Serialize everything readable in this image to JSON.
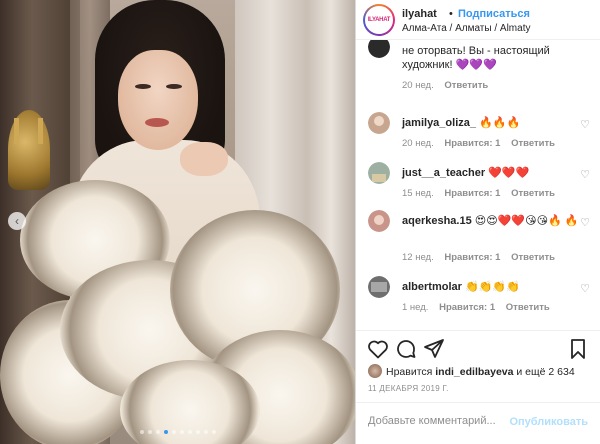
{
  "post": {
    "image_alt": "",
    "carousel": {
      "count": 10,
      "active_index": 3
    },
    "prev_icon": "chevron-left-icon"
  },
  "header": {
    "avatar_text": "ILYAHAT",
    "username": "ilyahat",
    "separator": "•",
    "follow_label": "Подписаться",
    "location": "Алма-Ата / Алматы / Almaty"
  },
  "comments": [
    {
      "username": "",
      "text": "не оторвать! Вы - настоящий художник! 💜💜💜",
      "time": "20 нед.",
      "likes": "",
      "reply": "Ответить",
      "avatar_color": "#2a2a2a",
      "has_heart": false
    },
    {
      "username": "jamilya_oliza_",
      "text": "🔥🔥🔥",
      "time": "20 нед.",
      "likes": "Нравится: 1",
      "reply": "Ответить",
      "avatar_color": "#c7a58f",
      "has_heart": true
    },
    {
      "username": "just__a_teacher",
      "text": "❤️❤️❤️",
      "time": "15 нед.",
      "likes": "Нравится: 1",
      "reply": "Ответить",
      "avatar_color": "#9db0a2",
      "has_heart": true
    },
    {
      "username": "aqerkesha.15",
      "text": "😍😍❤️❤️😘😘🔥 🔥",
      "time": "12 нед.",
      "likes": "Нравится: 1",
      "reply": "Ответить",
      "avatar_color": "#c9948a",
      "has_heart": true
    },
    {
      "username": "albertmolar",
      "text": "👏👏👏👏",
      "time": "1 нед.",
      "likes": "Нравится: 1",
      "reply": "Ответить",
      "avatar_color": "#6e6e6e",
      "has_heart": true
    }
  ],
  "actions": {
    "like_icon": "heart-outline-icon",
    "comment_icon": "comment-bubble-icon",
    "share_icon": "paper-plane-icon",
    "save_icon": "bookmark-icon"
  },
  "likes": {
    "prefix": "Нравится",
    "user": "indi_edilbayeva",
    "suffix": "и ещё 2 634"
  },
  "date": "11 ДЕКАБРЯ 2019 Г.",
  "add_comment": {
    "placeholder": "Добавьте комментарий...",
    "publish_label": "Опубликовать"
  },
  "colors": {
    "accent": "#3897f0",
    "publish_disabled": "#b2dffc",
    "muted": "#8e8e8e",
    "text": "#262626"
  }
}
